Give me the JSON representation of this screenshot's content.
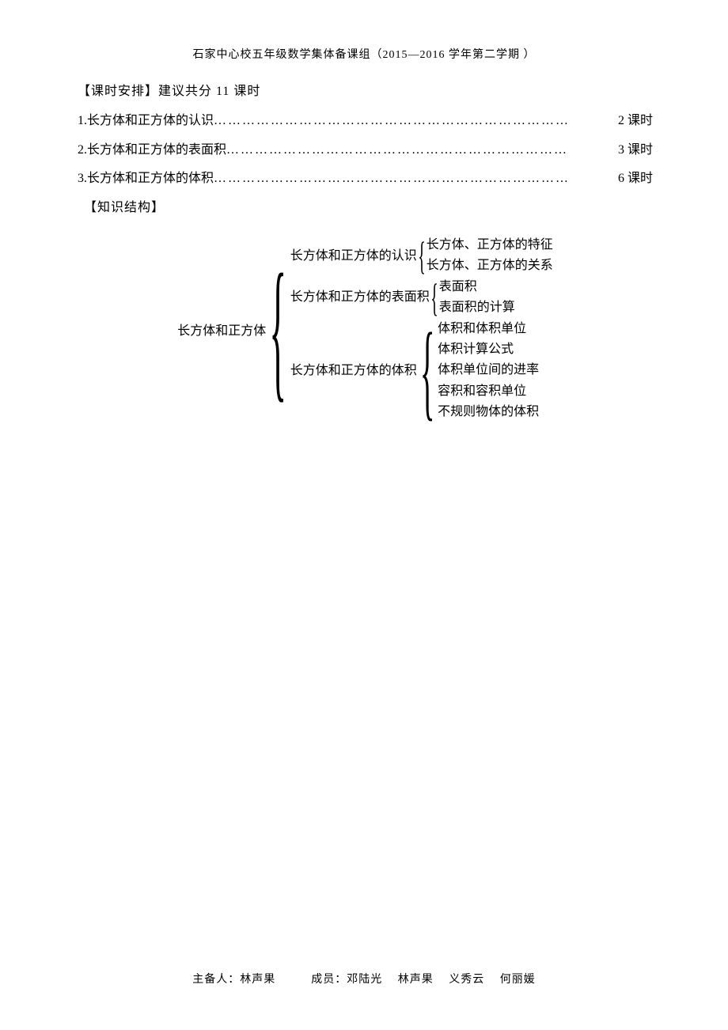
{
  "header": "石家中心校五年级数学集体备课组（2015—2016 学年第二学期 ）",
  "section_time": "【课时安排】建议共分 11 课时",
  "toc": [
    {
      "label": "1.长方体和正方体的认识",
      "hours": "2 课时"
    },
    {
      "label": "2.长方体和正方体的表面积",
      "hours": "3 课时"
    },
    {
      "label": "3.长方体和正方体的体积",
      "hours": "6 课时"
    }
  ],
  "section_structure": "【知识结构】",
  "diagram": {
    "root": "长方体和正方体",
    "branches": [
      {
        "label": "长方体和正方体的认识",
        "children": [
          "长方体、正方体的特征",
          "长方体、正方体的关系"
        ]
      },
      {
        "label": "长方体和正方体的表面积",
        "children": [
          "表面积",
          "表面积的计算"
        ]
      },
      {
        "label": "长方体和正方体的体积",
        "children": [
          "体积和体积单位",
          "体积计算公式",
          "体积单位间的进率",
          "容积和容积单位",
          "不规则物体的体积"
        ]
      }
    ]
  },
  "footer": "主备人：林声果　　　成员：邓陆光　 林声果　 义秀云　 何丽媛"
}
